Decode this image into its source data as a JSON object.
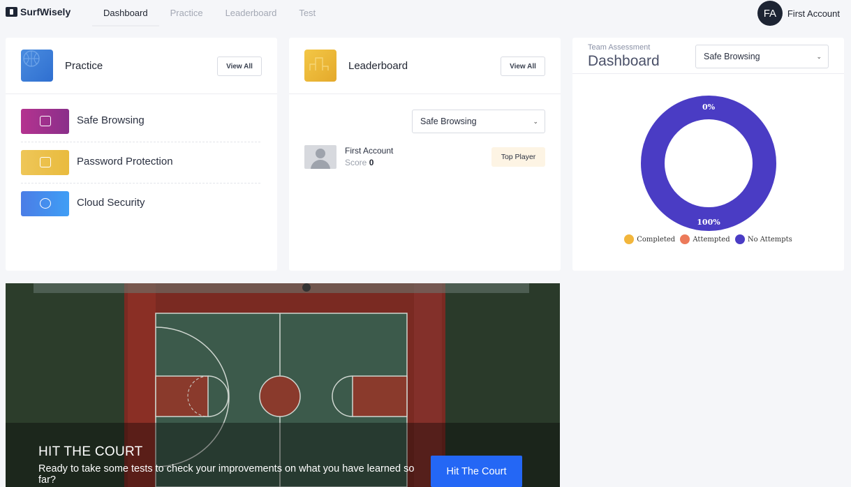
{
  "app": {
    "name": "SurfWisely"
  },
  "nav": {
    "links": [
      "Dashboard",
      "Practice",
      "Leaderboard",
      "Test"
    ],
    "active": "Dashboard"
  },
  "user": {
    "initials": "FA",
    "name": "First Account"
  },
  "practice": {
    "title": "Practice",
    "view_all": "View All",
    "items": [
      {
        "label": "Safe Browsing",
        "icon": "browser-lock-icon"
      },
      {
        "label": "Password Protection",
        "icon": "password-icon"
      },
      {
        "label": "Cloud Security",
        "icon": "cloud-lock-icon"
      }
    ]
  },
  "leaderboard": {
    "title": "Leaderboard",
    "view_all": "View All",
    "filter": "Safe Browsing",
    "entry": {
      "name": "First Account",
      "score_label": "Score",
      "score": "0",
      "badge": "Top Player"
    }
  },
  "team_assessment": {
    "label": "Team Assessment",
    "title": "Dashboard",
    "filter": "Safe Browsing"
  },
  "chart_data": {
    "type": "pie",
    "donut": true,
    "categories": [
      "Completed",
      "Attempted",
      "No Attempts"
    ],
    "values": [
      0,
      0,
      100
    ],
    "data_labels": [
      "0%",
      "100%"
    ],
    "colors": [
      "#f2b63c",
      "#ec7a5a",
      "#4a3cc4"
    ],
    "legend": "bottom"
  },
  "banner": {
    "title": "HIT THE COURT",
    "text": "Ready to take some tests to check your improvements on what you have learned so far?",
    "button": "Hit The Court"
  }
}
